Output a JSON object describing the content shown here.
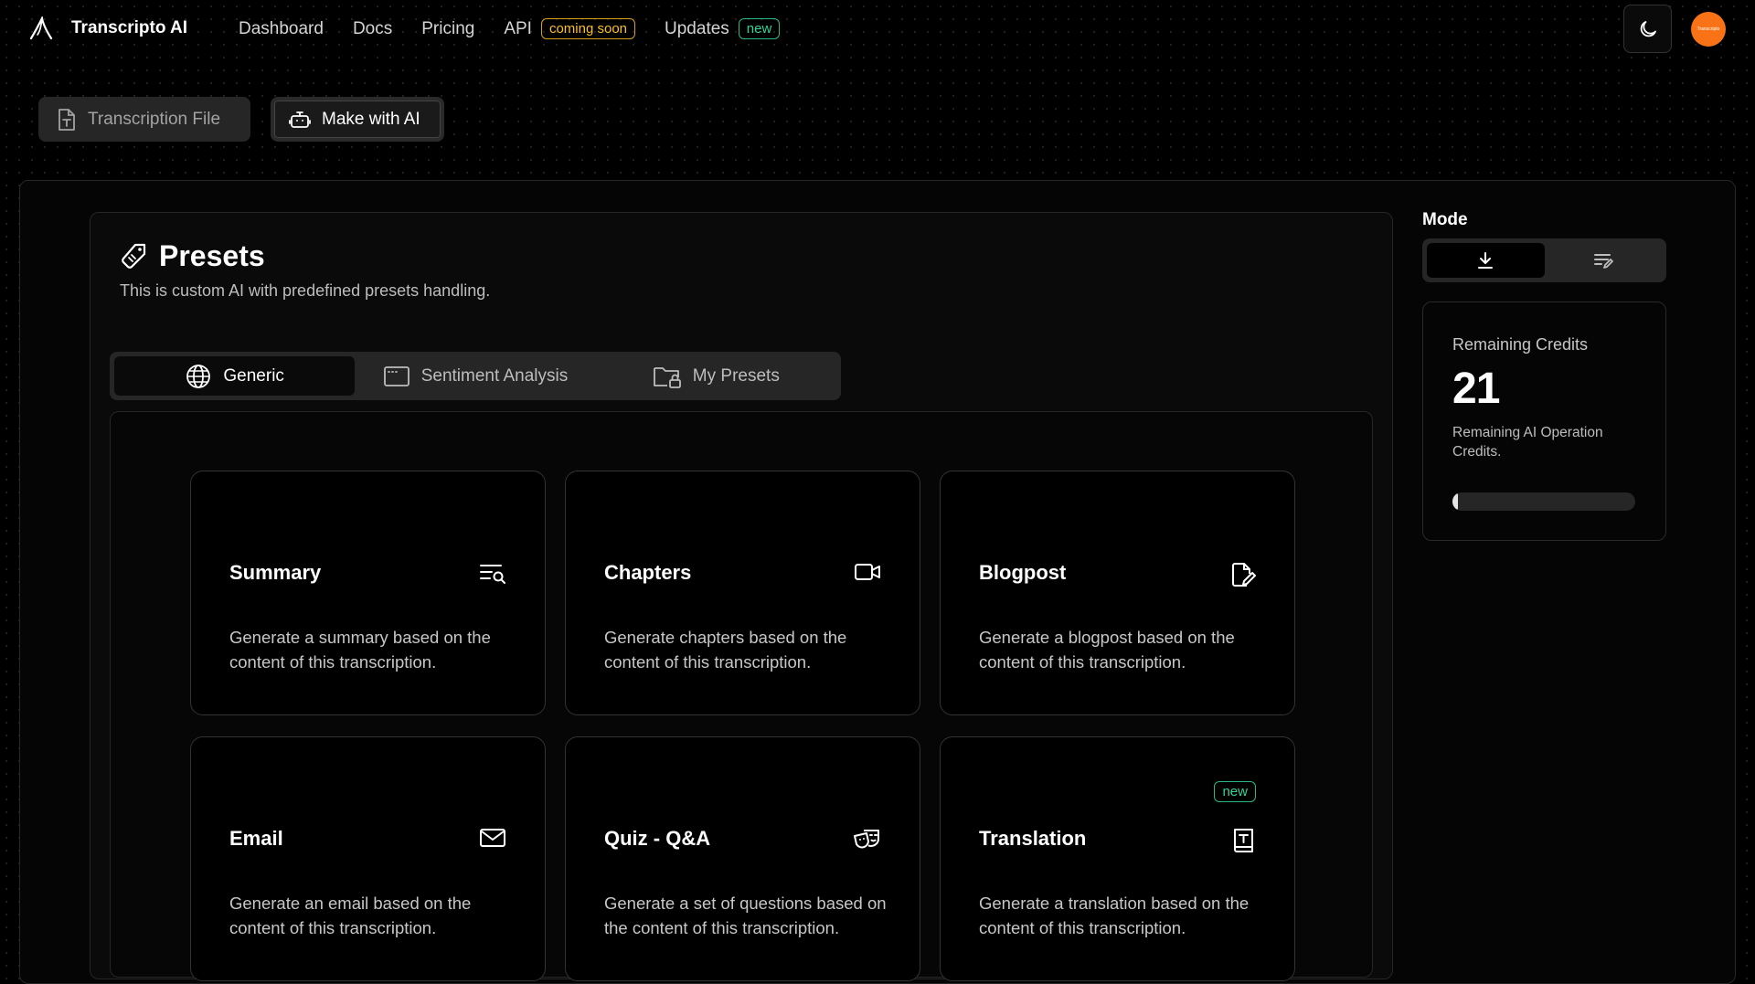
{
  "app": {
    "name": "Transcripto AI"
  },
  "nav": {
    "items": [
      {
        "label": "Dashboard"
      },
      {
        "label": "Docs"
      },
      {
        "label": "Pricing"
      },
      {
        "label": "API",
        "badge": "coming soon"
      },
      {
        "label": "Updates",
        "badge": "new"
      }
    ]
  },
  "header": {
    "avatar_text": "Transcripto"
  },
  "top_tabs": [
    {
      "label": "Transcription File",
      "icon": "file-text-icon",
      "active": false
    },
    {
      "label": "Make with AI",
      "icon": "robot-icon",
      "active": true
    }
  ],
  "presets": {
    "title": "Presets",
    "subtitle": "This is custom AI with predefined presets handling.",
    "tabs": [
      {
        "label": "Generic",
        "icon": "globe-icon",
        "active": true
      },
      {
        "label": "Sentiment Analysis",
        "icon": "window-icon",
        "active": false
      },
      {
        "label": "My Presets",
        "icon": "folder-lock-icon",
        "active": false
      }
    ],
    "cards": [
      {
        "title": "Summary",
        "icon": "list-search-icon",
        "description": "Generate a summary based on the content of this transcription."
      },
      {
        "title": "Chapters",
        "icon": "video-icon",
        "description": "Generate chapters based on the content of this transcription."
      },
      {
        "title": "Blogpost",
        "icon": "file-pencil-icon",
        "description": "Generate a blogpost based on the content of this transcription."
      },
      {
        "title": "Email",
        "icon": "mail-icon",
        "description": "Generate an email based on the content of this transcription."
      },
      {
        "title": "Quiz - Q&A",
        "icon": "masks-icon",
        "description": "Generate a set of questions based on the content of this transcription."
      },
      {
        "title": "Translation",
        "icon": "book-text-icon",
        "badge": "new",
        "description": "Generate a translation based on the content of this transcription."
      }
    ]
  },
  "sidebar": {
    "mode_label": "Mode",
    "modes": [
      {
        "icon": "download-icon",
        "active": true
      },
      {
        "icon": "edit-list-icon",
        "active": false
      }
    ],
    "credits": {
      "label": "Remaining Credits",
      "value": "21",
      "description": "Remaining AI Operation Credits.",
      "progress_fraction": 0.02
    }
  },
  "colors": {
    "accent_orange": "#f97316",
    "badge_soon": "#fbbf24",
    "badge_new": "#34d399"
  }
}
